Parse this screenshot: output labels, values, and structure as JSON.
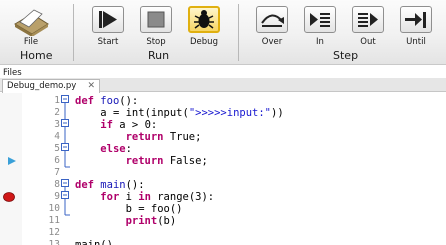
{
  "toolbar": {
    "file": {
      "label": "File",
      "group": "Home"
    },
    "run": {
      "group": "Run",
      "start": "Start",
      "stop": "Stop",
      "debug": "Debug"
    },
    "step": {
      "group": "Step",
      "over": "Over",
      "in": "In",
      "out": "Out",
      "until": "Until"
    }
  },
  "files": {
    "label": "Files",
    "tab": "Debug_demo.py",
    "tab_close": "✕"
  },
  "editor": {
    "lines": [
      {
        "num": "1",
        "code": "def foo():"
      },
      {
        "num": "2",
        "code": "    a = int(input(\">>>>>input:\"))"
      },
      {
        "num": "3",
        "code": "    if a > 0:"
      },
      {
        "num": "4",
        "code": "        return True;"
      },
      {
        "num": "5",
        "code": "    else:"
      },
      {
        "num": "6",
        "code": "        return False;"
      },
      {
        "num": "7",
        "code": ""
      },
      {
        "num": "8",
        "code": "def main():"
      },
      {
        "num": "9",
        "code": "    for i in range(3):"
      },
      {
        "num": "10",
        "code": "        b = foo()"
      },
      {
        "num": "11",
        "code": "        print(b)"
      },
      {
        "num": "12",
        "code": ""
      },
      {
        "num": "13",
        "code": "main()"
      }
    ]
  },
  "markers": {
    "current_line": 6,
    "breakpoint_line": 9
  },
  "colors": {
    "keyword": "#b0006a",
    "function": "#1818b8",
    "string": "#1818d0",
    "line_number": "#8a8a8a",
    "breakpoint": "#d01818",
    "current_line": "#3aa0d8"
  },
  "icons": {
    "file": "folder-document-icon",
    "start": "play-icon",
    "stop": "stop-icon",
    "debug": "bug-icon",
    "over": "step-over-icon",
    "in": "step-in-icon",
    "out": "step-out-icon",
    "until": "step-until-icon",
    "current": "current-line-arrow-icon",
    "breakpoint": "breakpoint-icon"
  }
}
